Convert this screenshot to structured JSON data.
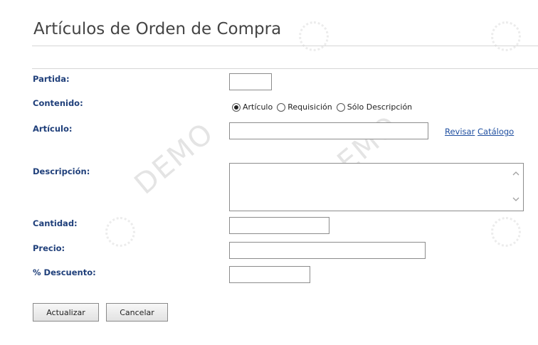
{
  "page": {
    "title": "Artículos de Orden de Compra"
  },
  "watermark": {
    "text": "DEMO"
  },
  "form": {
    "partida": {
      "label": "Partida:",
      "value": ""
    },
    "contenido": {
      "label": "Contenido:",
      "options": [
        "Artículo",
        "Requisición",
        "Sólo Descripción"
      ],
      "selected": "Artículo"
    },
    "articulo": {
      "label": "Artículo:",
      "value": "",
      "links": {
        "revisar": "Revisar",
        "catalogo": "Catálogo"
      }
    },
    "descripcion": {
      "label": "Descripción:",
      "value": ""
    },
    "cantidad": {
      "label": "Cantidad:",
      "value": ""
    },
    "precio": {
      "label": "Precio:",
      "value": ""
    },
    "descuento": {
      "label": "% Descuento:",
      "value": ""
    }
  },
  "buttons": {
    "actualizar": "Actualizar",
    "cancelar": "Cancelar"
  },
  "colors": {
    "label": "#1f3f7a",
    "link": "#1f4fa0",
    "title": "#444444"
  },
  "icons": {
    "scroll_up": "chevron-up-icon",
    "scroll_down": "chevron-down-icon"
  }
}
